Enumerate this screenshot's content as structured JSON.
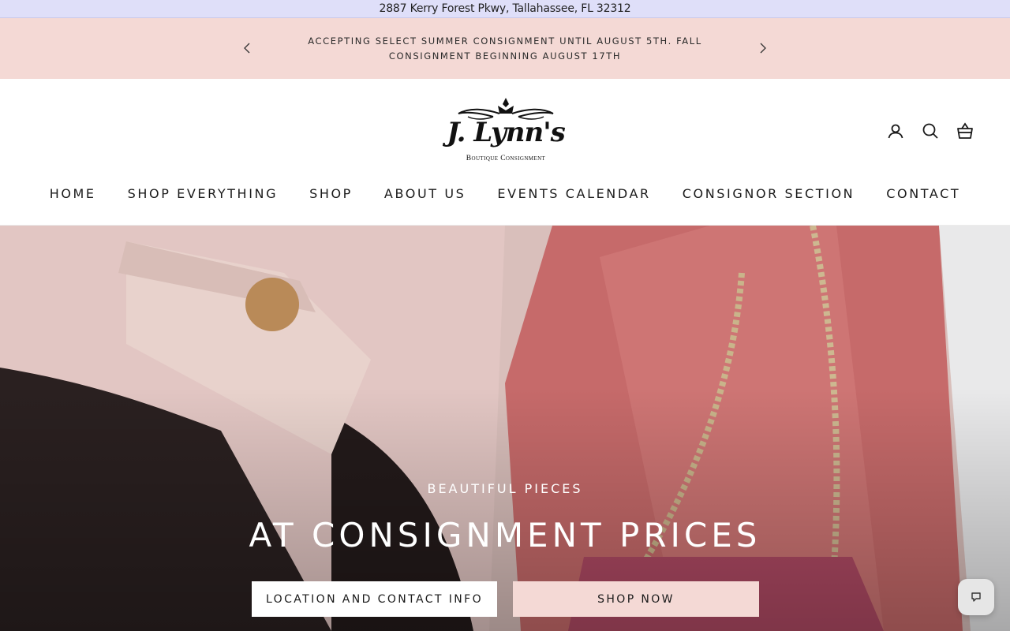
{
  "topbar": {
    "address": "2887 Kerry Forest Pkwy, Tallahassee, FL 32312"
  },
  "announcement": {
    "line1": "ACCEPTING SELECT SUMMER CONSIGNMENT UNTIL AUGUST 5TH. FALL",
    "line2": "CONSIGNMENT BEGINNING AUGUST 17TH",
    "prev_icon": "chevron-left-icon",
    "next_icon": "chevron-right-icon",
    "background": "#f4d9d5"
  },
  "logo": {
    "script": "J. Lynn's",
    "subtitle": "Boutique Consignment"
  },
  "header_icons": [
    "account-icon",
    "search-icon",
    "cart-icon"
  ],
  "nav": {
    "items": [
      {
        "label": "HOME"
      },
      {
        "label": "SHOP EVERYTHING"
      },
      {
        "label": "SHOP"
      },
      {
        "label": "ABOUT US"
      },
      {
        "label": "EVENTS CALENDAR"
      },
      {
        "label": "CONSIGNOR SECTION"
      },
      {
        "label": "CONTACT"
      }
    ]
  },
  "hero": {
    "eyebrow": "BEAUTIFUL PIECES",
    "title": "AT CONSIGNMENT PRICES",
    "buttons": {
      "location": "LOCATION AND CONTACT INFO",
      "shop": "SHOP NOW"
    }
  },
  "chat": {
    "icon": "chat-icon"
  },
  "colors": {
    "accent": "#f4d9d5",
    "topbar": "#dfdff9"
  }
}
